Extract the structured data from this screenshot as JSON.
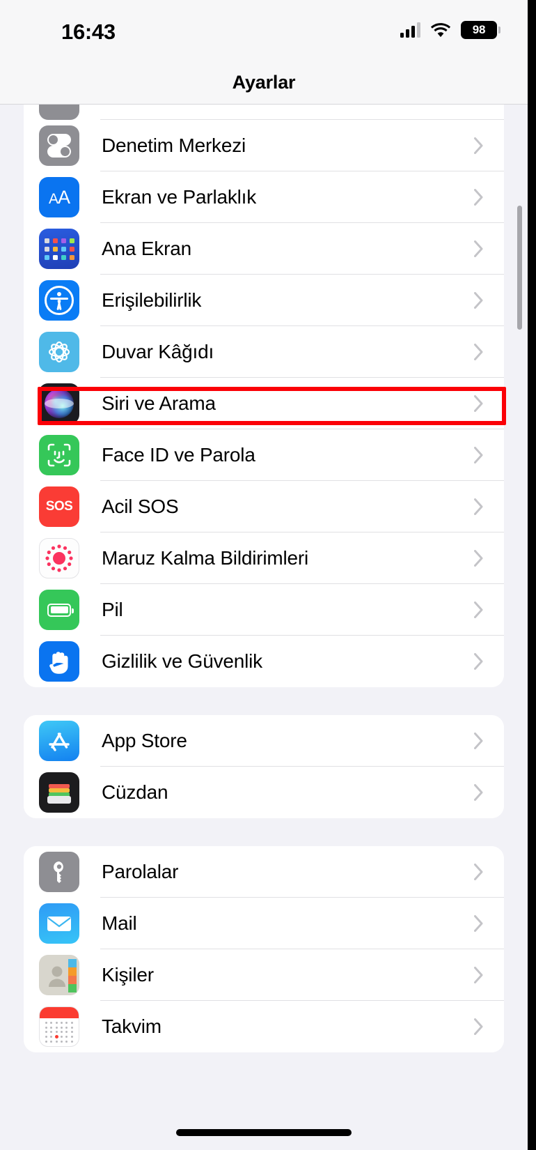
{
  "status_bar": {
    "time": "16:43",
    "battery_percent": "98",
    "signal_icon": "cellular-bars-icon",
    "wifi_icon": "wifi-icon",
    "battery_icon": "battery-icon"
  },
  "navbar": {
    "title": "Ayarlar"
  },
  "highlight": {
    "target_label": "Erişilebilirlik",
    "color": "#fb0007"
  },
  "groups": [
    {
      "id": "system-group",
      "cut_top": true,
      "rows": [
        {
          "label": "Denetim Merkezi",
          "icon": "control-center-icon",
          "chevron": "chevron-right-icon"
        },
        {
          "label": "Ekran ve Parlaklık",
          "icon": "display-brightness-icon",
          "chevron": "chevron-right-icon"
        },
        {
          "label": "Ana Ekran",
          "icon": "home-screen-icon",
          "chevron": "chevron-right-icon"
        },
        {
          "label": "Erişilebilirlik",
          "icon": "accessibility-icon",
          "chevron": "chevron-right-icon"
        },
        {
          "label": "Duvar Kâğıdı",
          "icon": "wallpaper-icon",
          "chevron": "chevron-right-icon"
        },
        {
          "label": "Siri ve Arama",
          "icon": "siri-icon",
          "chevron": "chevron-right-icon"
        },
        {
          "label": "Face ID ve Parola",
          "icon": "face-id-icon",
          "chevron": "chevron-right-icon"
        },
        {
          "label": "Acil SOS",
          "icon": "emergency-sos-icon",
          "chevron": "chevron-right-icon"
        },
        {
          "label": "Maruz Kalma Bildirimleri",
          "icon": "exposure-notifications-icon",
          "chevron": "chevron-right-icon"
        },
        {
          "label": "Pil",
          "icon": "battery-settings-icon",
          "chevron": "chevron-right-icon"
        },
        {
          "label": "Gizlilik ve Güvenlik",
          "icon": "privacy-hand-icon",
          "chevron": "chevron-right-icon"
        }
      ]
    },
    {
      "id": "store-group",
      "cut_top": false,
      "rows": [
        {
          "label": "App Store",
          "icon": "app-store-icon",
          "chevron": "chevron-right-icon"
        },
        {
          "label": "Cüzdan",
          "icon": "wallet-icon",
          "chevron": "chevron-right-icon"
        }
      ]
    },
    {
      "id": "apps-group",
      "cut_top": false,
      "rows": [
        {
          "label": "Parolalar",
          "icon": "passwords-key-icon",
          "chevron": "chevron-right-icon"
        },
        {
          "label": "Mail",
          "icon": "mail-icon",
          "chevron": "chevron-right-icon"
        },
        {
          "label": "Kişiler",
          "icon": "contacts-icon",
          "chevron": "chevron-right-icon"
        },
        {
          "label": "Takvim",
          "icon": "calendar-icon",
          "chevron": "chevron-right-icon"
        }
      ]
    }
  ]
}
